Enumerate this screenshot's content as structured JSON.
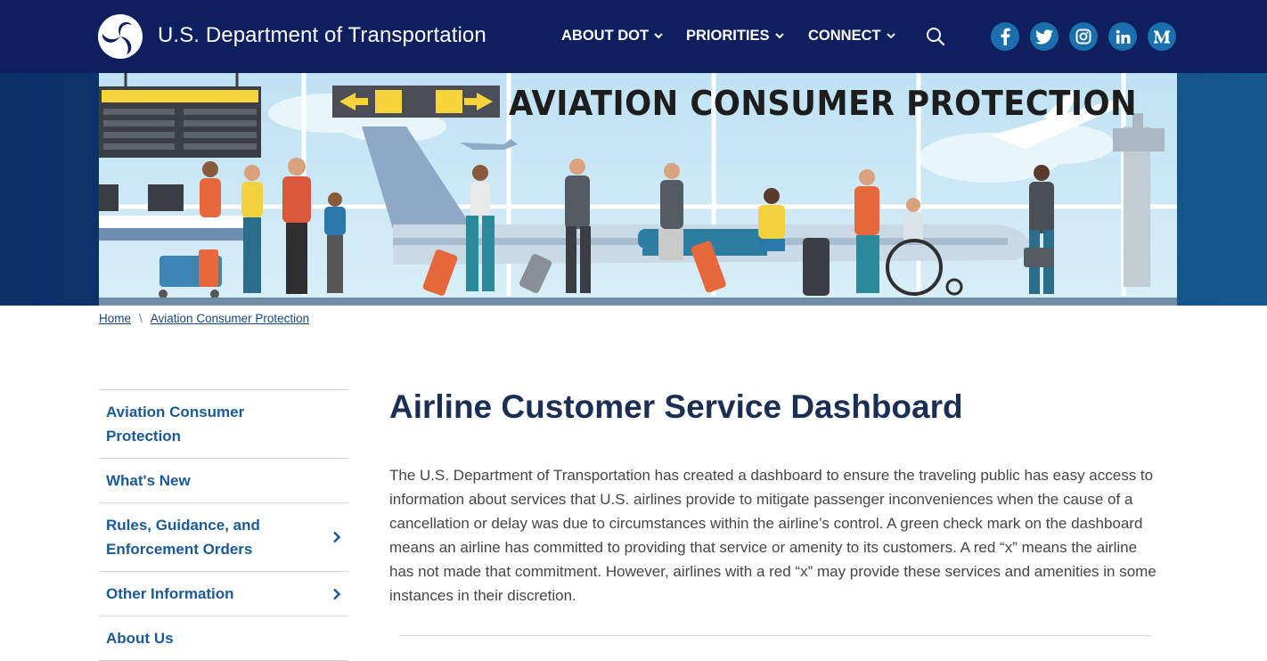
{
  "header": {
    "site_title": "U.S. Department of Transportation",
    "nav": [
      {
        "label": "ABOUT DOT"
      },
      {
        "label": "PRIORITIES"
      },
      {
        "label": "CONNECT"
      }
    ],
    "social": [
      {
        "icon": "facebook-icon",
        "glyph": "f"
      },
      {
        "icon": "twitter-icon",
        "glyph": "t"
      },
      {
        "icon": "instagram-icon",
        "glyph": "ig"
      },
      {
        "icon": "linkedin-icon",
        "glyph": "in"
      },
      {
        "icon": "medium-icon",
        "glyph": "M"
      }
    ],
    "colors": {
      "header_bg": "#0d1f5e",
      "social_bg": "#1b6fad"
    }
  },
  "hero": {
    "title": "AVIATION CONSUMER PROTECTION"
  },
  "breadcrumb": {
    "home": "Home",
    "separator": "\\",
    "current": "Aviation Consumer Protection"
  },
  "sidenav": {
    "items": [
      {
        "label": "Aviation Consumer Protection",
        "has_children": false
      },
      {
        "label": "What's New",
        "has_children": false
      },
      {
        "label": "Rules, Guidance, and Enforcement Orders",
        "has_children": true
      },
      {
        "label": "Other Information",
        "has_children": true
      },
      {
        "label": "About Us",
        "has_children": false
      }
    ]
  },
  "main": {
    "title": "Airline Customer Service Dashboard",
    "intro": "The U.S. Department of Transportation has created a dashboard to ensure the traveling public has easy access to information about services that U.S. airlines provide to mitigate passenger inconveniences when the cause of a cancellation or delay was due to circumstances within the airline’s control. A green check mark on the dashboard means an airline has committed to providing that service or amenity to its customers. A red “x” means the airline has not made that commitment. However, airlines with a red “x” may provide these services and amenities in some instances in their discretion."
  }
}
